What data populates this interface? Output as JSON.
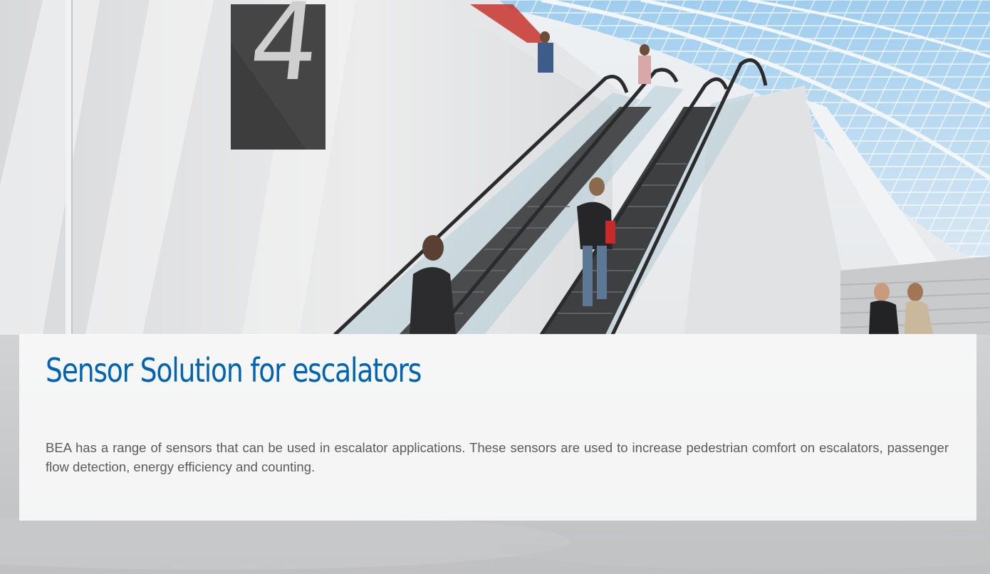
{
  "hero": {
    "title": "Sensor Solution for escalators",
    "description": "BEA has a range of sensors that can be used in escalator applications. These sensors are used to increase pedestrian comfort on escalators, passenger flow detection, energy efficiency and counting.",
    "floor_sign": "4"
  },
  "colors": {
    "title_blue": "#0064b4",
    "body_text": "#5b5b5b",
    "overlay": "#fafafa",
    "sign_dark": "#3d3d3d",
    "sky_blue": "#8fc1e8"
  },
  "background": {
    "icon": "escalator-station-photo"
  }
}
